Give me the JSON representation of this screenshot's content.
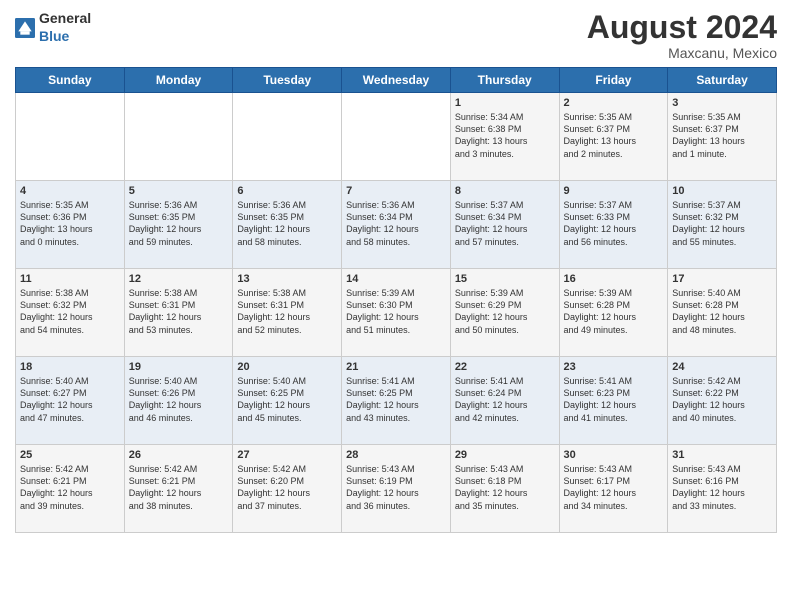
{
  "header": {
    "logo_general": "General",
    "logo_blue": "Blue",
    "month": "August 2024",
    "location": "Maxcanu, Mexico"
  },
  "days_of_week": [
    "Sunday",
    "Monday",
    "Tuesday",
    "Wednesday",
    "Thursday",
    "Friday",
    "Saturday"
  ],
  "weeks": [
    [
      {
        "day": "",
        "content": ""
      },
      {
        "day": "",
        "content": ""
      },
      {
        "day": "",
        "content": ""
      },
      {
        "day": "",
        "content": ""
      },
      {
        "day": "1",
        "content": "Sunrise: 5:34 AM\nSunset: 6:38 PM\nDaylight: 13 hours\nand 3 minutes."
      },
      {
        "day": "2",
        "content": "Sunrise: 5:35 AM\nSunset: 6:37 PM\nDaylight: 13 hours\nand 2 minutes."
      },
      {
        "day": "3",
        "content": "Sunrise: 5:35 AM\nSunset: 6:37 PM\nDaylight: 13 hours\nand 1 minute."
      }
    ],
    [
      {
        "day": "4",
        "content": "Sunrise: 5:35 AM\nSunset: 6:36 PM\nDaylight: 13 hours\nand 0 minutes."
      },
      {
        "day": "5",
        "content": "Sunrise: 5:36 AM\nSunset: 6:35 PM\nDaylight: 12 hours\nand 59 minutes."
      },
      {
        "day": "6",
        "content": "Sunrise: 5:36 AM\nSunset: 6:35 PM\nDaylight: 12 hours\nand 58 minutes."
      },
      {
        "day": "7",
        "content": "Sunrise: 5:36 AM\nSunset: 6:34 PM\nDaylight: 12 hours\nand 58 minutes."
      },
      {
        "day": "8",
        "content": "Sunrise: 5:37 AM\nSunset: 6:34 PM\nDaylight: 12 hours\nand 57 minutes."
      },
      {
        "day": "9",
        "content": "Sunrise: 5:37 AM\nSunset: 6:33 PM\nDaylight: 12 hours\nand 56 minutes."
      },
      {
        "day": "10",
        "content": "Sunrise: 5:37 AM\nSunset: 6:32 PM\nDaylight: 12 hours\nand 55 minutes."
      }
    ],
    [
      {
        "day": "11",
        "content": "Sunrise: 5:38 AM\nSunset: 6:32 PM\nDaylight: 12 hours\nand 54 minutes."
      },
      {
        "day": "12",
        "content": "Sunrise: 5:38 AM\nSunset: 6:31 PM\nDaylight: 12 hours\nand 53 minutes."
      },
      {
        "day": "13",
        "content": "Sunrise: 5:38 AM\nSunset: 6:31 PM\nDaylight: 12 hours\nand 52 minutes."
      },
      {
        "day": "14",
        "content": "Sunrise: 5:39 AM\nSunset: 6:30 PM\nDaylight: 12 hours\nand 51 minutes."
      },
      {
        "day": "15",
        "content": "Sunrise: 5:39 AM\nSunset: 6:29 PM\nDaylight: 12 hours\nand 50 minutes."
      },
      {
        "day": "16",
        "content": "Sunrise: 5:39 AM\nSunset: 6:28 PM\nDaylight: 12 hours\nand 49 minutes."
      },
      {
        "day": "17",
        "content": "Sunrise: 5:40 AM\nSunset: 6:28 PM\nDaylight: 12 hours\nand 48 minutes."
      }
    ],
    [
      {
        "day": "18",
        "content": "Sunrise: 5:40 AM\nSunset: 6:27 PM\nDaylight: 12 hours\nand 47 minutes."
      },
      {
        "day": "19",
        "content": "Sunrise: 5:40 AM\nSunset: 6:26 PM\nDaylight: 12 hours\nand 46 minutes."
      },
      {
        "day": "20",
        "content": "Sunrise: 5:40 AM\nSunset: 6:25 PM\nDaylight: 12 hours\nand 45 minutes."
      },
      {
        "day": "21",
        "content": "Sunrise: 5:41 AM\nSunset: 6:25 PM\nDaylight: 12 hours\nand 43 minutes."
      },
      {
        "day": "22",
        "content": "Sunrise: 5:41 AM\nSunset: 6:24 PM\nDaylight: 12 hours\nand 42 minutes."
      },
      {
        "day": "23",
        "content": "Sunrise: 5:41 AM\nSunset: 6:23 PM\nDaylight: 12 hours\nand 41 minutes."
      },
      {
        "day": "24",
        "content": "Sunrise: 5:42 AM\nSunset: 6:22 PM\nDaylight: 12 hours\nand 40 minutes."
      }
    ],
    [
      {
        "day": "25",
        "content": "Sunrise: 5:42 AM\nSunset: 6:21 PM\nDaylight: 12 hours\nand 39 minutes."
      },
      {
        "day": "26",
        "content": "Sunrise: 5:42 AM\nSunset: 6:21 PM\nDaylight: 12 hours\nand 38 minutes."
      },
      {
        "day": "27",
        "content": "Sunrise: 5:42 AM\nSunset: 6:20 PM\nDaylight: 12 hours\nand 37 minutes."
      },
      {
        "day": "28",
        "content": "Sunrise: 5:43 AM\nSunset: 6:19 PM\nDaylight: 12 hours\nand 36 minutes."
      },
      {
        "day": "29",
        "content": "Sunrise: 5:43 AM\nSunset: 6:18 PM\nDaylight: 12 hours\nand 35 minutes."
      },
      {
        "day": "30",
        "content": "Sunrise: 5:43 AM\nSunset: 6:17 PM\nDaylight: 12 hours\nand 34 minutes."
      },
      {
        "day": "31",
        "content": "Sunrise: 5:43 AM\nSunset: 6:16 PM\nDaylight: 12 hours\nand 33 minutes."
      }
    ]
  ]
}
